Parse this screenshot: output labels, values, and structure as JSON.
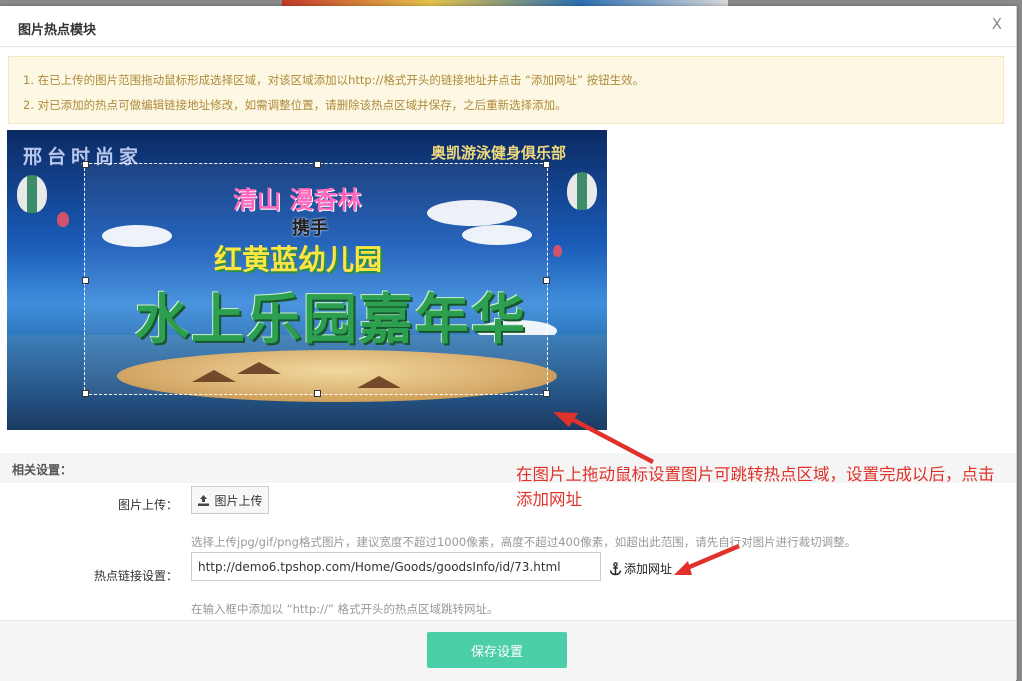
{
  "dialog": {
    "title": "图片热点模块",
    "close_label": "X"
  },
  "notice": {
    "line1": "1. 在已上传的图片范围拖动鼠标形成选择区域，对该区域添加以http://格式开头的链接地址并点击 “添加网址” 按钮生效。",
    "line2": "2. 对已添加的热点可做编辑链接地址修改，如需调整位置，请删除该热点区域并保存，之后重新选择添加。"
  },
  "banner": {
    "top_left_text": "邢台时尚家",
    "top_right_text": "奥凯游泳健身俱乐部",
    "line1": "清山 漫香林",
    "line2": "携手",
    "line3": "红黄蓝幼儿园",
    "line4": "水上乐园嘉年华"
  },
  "settings": {
    "section_title": "相关设置：",
    "upload_label": "图片上传：",
    "upload_button": "图片上传",
    "upload_hint": "选择上传jpg/gif/png格式图片，建议宽度不超过1000像素，高度不超过400像素，如超出此范围，请先自行对图片进行裁切调整。",
    "link_label": "热点链接设置：",
    "link_value": "http://demo6.tpshop.com/Home/Goods/goodsInfo/id/73.html",
    "add_link_button": "添加网址",
    "link_hint": "在输入框中添加以 “http://” 格式开头的热点区域跳转网址。"
  },
  "annotation": {
    "text": "在图片上拖动鼠标设置图片可跳转热点区域，设置完成以后，点击添加网址"
  },
  "footer": {
    "save_button": "保存设置"
  },
  "colors": {
    "accent": "#4ccfa8",
    "notice_bg": "#fcf8e3",
    "notice_text": "#b08a3a",
    "annotation": "#e0322b"
  },
  "icons": [
    "close-icon",
    "upload-icon",
    "anchor-icon"
  ]
}
